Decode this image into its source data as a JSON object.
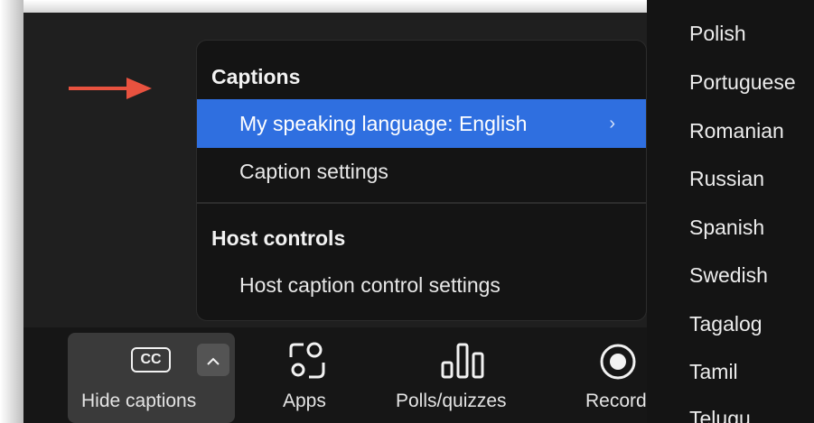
{
  "menu": {
    "captions_header": "Captions",
    "speaking_language": "My speaking language: English",
    "speaking_language_chevron": "›",
    "caption_settings": "Caption settings",
    "host_controls_header": "Host controls",
    "host_caption_settings": "Host caption control settings"
  },
  "languages": [
    "Polish",
    "Portuguese",
    "Romanian",
    "Russian",
    "Spanish",
    "Swedish",
    "Tagalog",
    "Tamil",
    "Telugu"
  ],
  "toolbar": {
    "hide_captions_label": "Hide captions",
    "cc_icon_text": "CC",
    "caret": "^",
    "apps_label": "Apps",
    "polls_label": "Polls/quizzes",
    "record_label": "Record"
  },
  "colors": {
    "selected": "#2f6fe0",
    "menu_bg": "#141414",
    "arrow": "#e8523f"
  }
}
